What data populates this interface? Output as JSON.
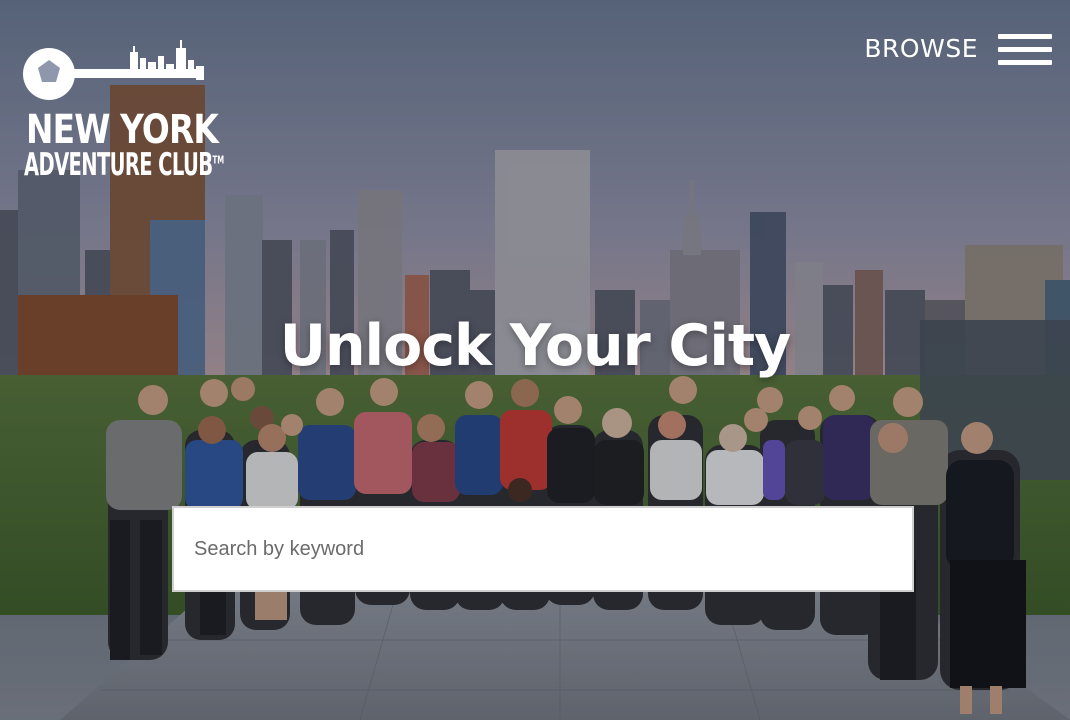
{
  "logo": {
    "line1": "NEW YORK",
    "line2": "ADVENTURE CLUB",
    "trademark": "TM",
    "icon": "key-skyline-icon"
  },
  "header": {
    "browse_label": "BROWSE",
    "menu_icon": "hamburger-menu-icon"
  },
  "hero": {
    "headline": "Unlock Your City",
    "background": "group-photo-rooftop-skyline"
  },
  "search": {
    "placeholder": "Search by keyword",
    "value": ""
  },
  "colors": {
    "text": "#ffffff",
    "search_bg": "#ffffff",
    "search_border": "#cfcfcf",
    "placeholder": "#6b6b6b"
  }
}
